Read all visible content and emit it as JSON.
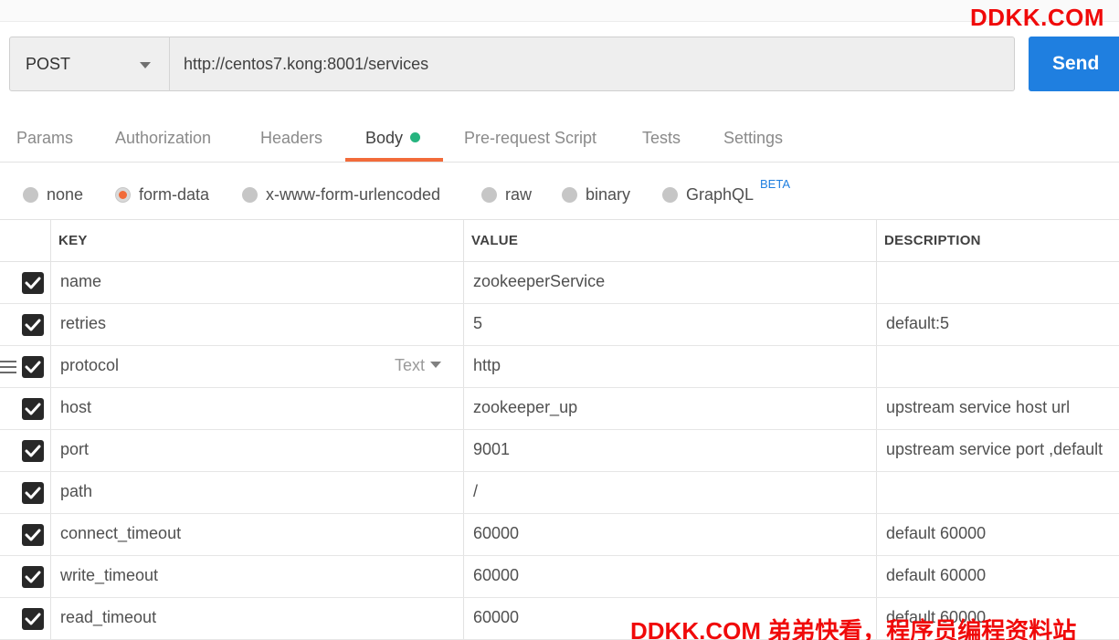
{
  "request": {
    "method": "POST",
    "url": "http://centos7.kong:8001/services",
    "send_label": "Send"
  },
  "tabs": [
    {
      "label": "Params"
    },
    {
      "label": "Authorization"
    },
    {
      "label": "Headers"
    },
    {
      "label": "Body",
      "active": true
    },
    {
      "label": "Pre-request Script"
    },
    {
      "label": "Tests"
    },
    {
      "label": "Settings"
    }
  ],
  "body_types": [
    {
      "label": "none"
    },
    {
      "label": "form-data",
      "selected": true
    },
    {
      "label": "x-www-form-urlencoded"
    },
    {
      "label": "raw"
    },
    {
      "label": "binary"
    },
    {
      "label": "GraphQL"
    }
  ],
  "beta_badge": "BETA",
  "table": {
    "headers": {
      "key": "KEY",
      "value": "VALUE",
      "description": "DESCRIPTION"
    },
    "type_selector": "Text",
    "rows": [
      {
        "key": "name",
        "value": "zookeeperService",
        "description": "",
        "checked": true
      },
      {
        "key": "retries",
        "value": "5",
        "description": "default:5",
        "checked": true
      },
      {
        "key": "protocol",
        "value": "http",
        "description": "",
        "checked": true
      },
      {
        "key": "host",
        "value": "zookeeper_up",
        "description": "upstream service host url",
        "checked": true
      },
      {
        "key": "port",
        "value": "9001",
        "description": "upstream service port ,default",
        "checked": true
      },
      {
        "key": "path",
        "value": "/",
        "description": "",
        "checked": true
      },
      {
        "key": "connect_timeout",
        "value": "60000",
        "description": "default 60000",
        "checked": true
      },
      {
        "key": "write_timeout",
        "value": "60000",
        "description": "default 60000",
        "checked": true
      },
      {
        "key": "read_timeout",
        "value": "60000",
        "description": "default 60000",
        "checked": true
      }
    ]
  },
  "watermark_top": "DDKK.COM",
  "watermark_bottom": "DDKK.COM 弟弟快看，程序员编程资料站",
  "colors": {
    "send": "#1f7fe0",
    "active_tab": "#f26b3a",
    "body_dot": "#26b47f",
    "watermark": "#f00a0a"
  }
}
